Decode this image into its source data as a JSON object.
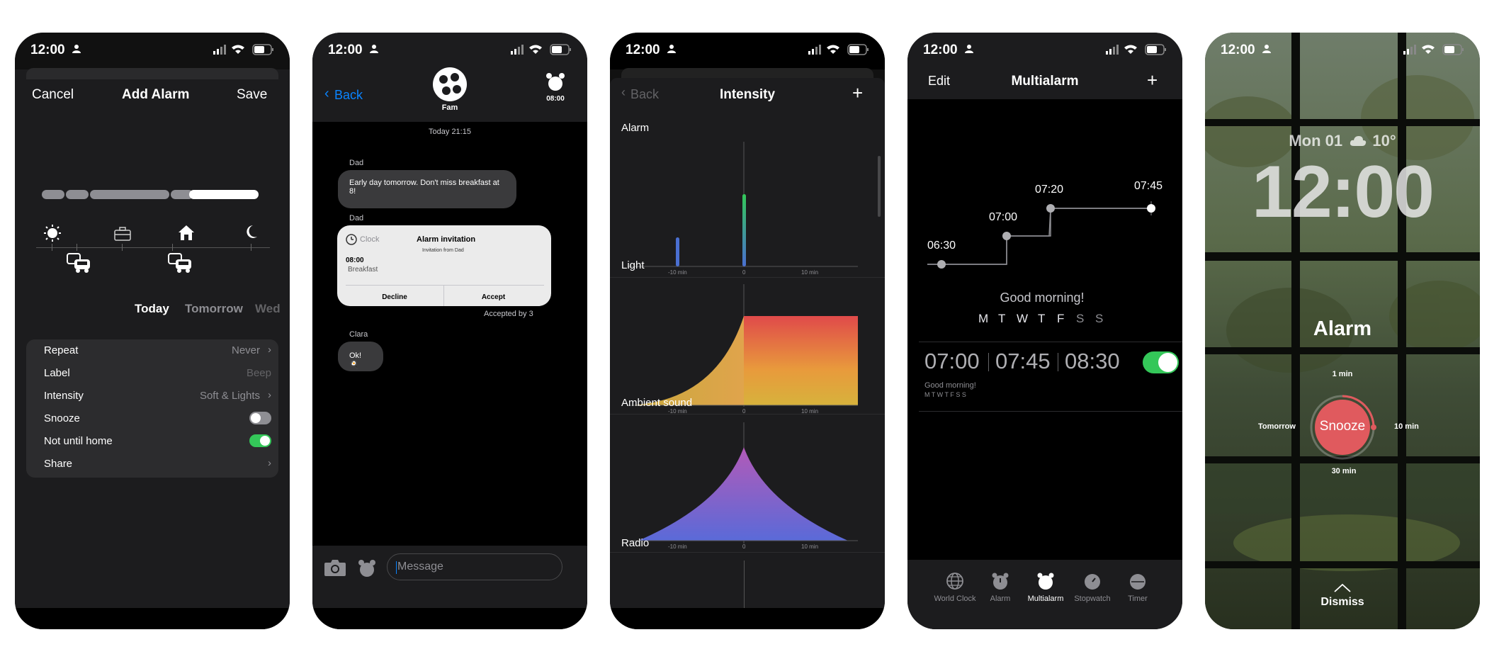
{
  "status": {
    "time": "12:00"
  },
  "add_alarm": {
    "cancel": "Cancel",
    "title": "Add Alarm",
    "save": "Save",
    "days": {
      "today": "Today",
      "tomorrow": "Tomorrow",
      "wed": "Wed"
    },
    "settings": [
      {
        "label": "Repeat",
        "value": "Never"
      },
      {
        "label": "Label",
        "value": "Beep"
      },
      {
        "label": "Intensity",
        "value": "Soft & Lights"
      },
      {
        "label": "Snooze",
        "toggle": false
      },
      {
        "label": "Not until home",
        "toggle": true
      },
      {
        "label": "Share",
        "value": ""
      }
    ],
    "accent": "#34c759"
  },
  "messages": {
    "back": "Back",
    "group_name": "Fam",
    "alarm_time": "08:00",
    "timestamp": "Today 21:15",
    "sender1": "Dad",
    "msg1": "Early day tomorrow. Don't miss breakfast at 8!",
    "sender2": "Dad",
    "invite": {
      "app": "Clock",
      "title": "Alarm invitation",
      "subtitle": "Invitation from Dad",
      "time": "08:00",
      "label": "Breakfast",
      "decline": "Decline",
      "accept": "Accept"
    },
    "accepted": "Accepted by 3",
    "sender3": "Clara",
    "msg3": "Ok! 🍳",
    "input_placeholder": "Message",
    "link_color": "#0a84ff"
  },
  "intensity": {
    "back": "Back",
    "title": "Intensity",
    "add": "+",
    "sections": {
      "alarm": "Alarm",
      "light": "Light",
      "ambient": "Ambient sound",
      "radio": "Radio"
    },
    "axis": {
      "left": "-10 min",
      "center": "0",
      "right": "10 min"
    }
  },
  "multialarm": {
    "edit": "Edit",
    "title": "Multialarm",
    "add": "+",
    "steps": [
      "06:30",
      "07:00",
      "07:20",
      "07:45"
    ],
    "greeting": "Good morning!",
    "weekdays": [
      "M",
      "T",
      "W",
      "T",
      "F",
      "S",
      "S"
    ],
    "row_times": [
      "07:00",
      "07:45",
      "08:30"
    ],
    "row_label": "Good morning!",
    "row_days": "M T W T F S S",
    "toggle_on": true,
    "tabs": [
      "World Clock",
      "Alarm",
      "Multialarm",
      "Stopwatch",
      "Timer"
    ],
    "active_tab": "Multialarm"
  },
  "lock": {
    "date": "Mon 01",
    "temp": "10°",
    "clock": "12:00",
    "alarm_title": "Alarm",
    "snooze": "Snooze",
    "opt_top": "1 min",
    "opt_right": "10 min",
    "opt_bottom": "30 min",
    "opt_left": "Tomorrow",
    "dismiss": "Dismiss",
    "snooze_color": "#e05a5e"
  }
}
